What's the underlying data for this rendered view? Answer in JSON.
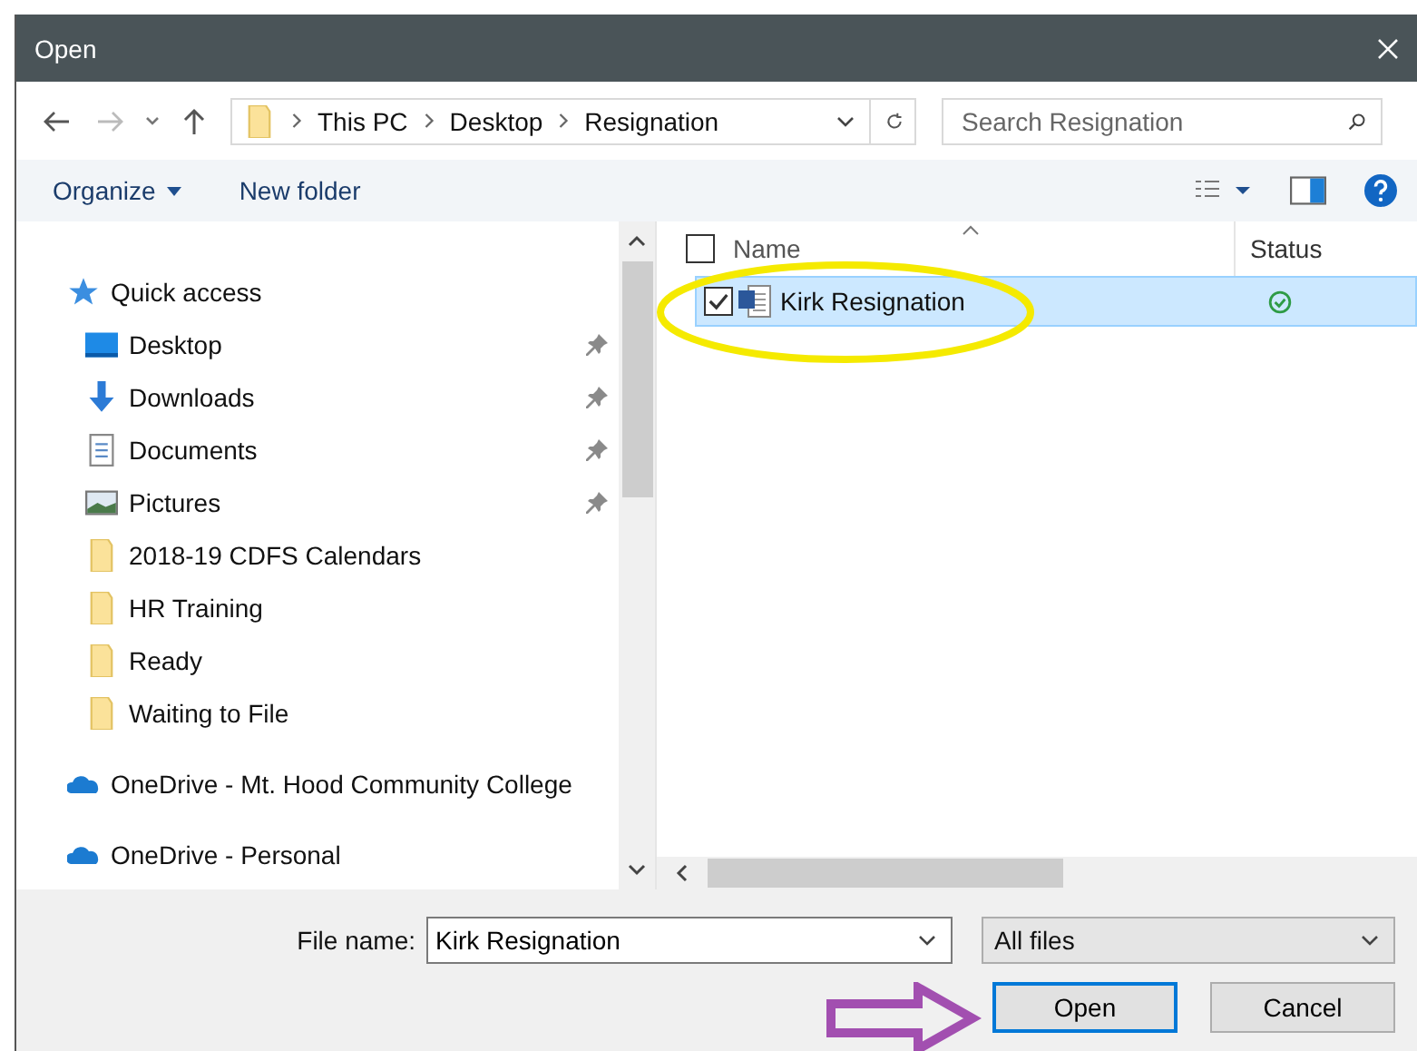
{
  "window": {
    "title": "Open"
  },
  "address": {
    "crumbs": [
      "This PC",
      "Desktop",
      "Resignation"
    ]
  },
  "search": {
    "placeholder": "Search Resignation"
  },
  "commands": {
    "organize": "Organize",
    "new_folder": "New folder"
  },
  "sidebar": {
    "items": [
      {
        "label": "Quick access",
        "kind": "quick-access",
        "children": [
          {
            "label": "Desktop",
            "kind": "desktop",
            "pinned": true
          },
          {
            "label": "Downloads",
            "kind": "downloads",
            "pinned": true
          },
          {
            "label": "Documents",
            "kind": "documents",
            "pinned": true
          },
          {
            "label": "Pictures",
            "kind": "pictures",
            "pinned": true
          },
          {
            "label": "2018-19 CDFS Calendars",
            "kind": "folder",
            "pinned": false
          },
          {
            "label": "HR Training",
            "kind": "folder",
            "pinned": false
          },
          {
            "label": "Ready",
            "kind": "folder",
            "pinned": false
          },
          {
            "label": "Waiting to File",
            "kind": "folder",
            "pinned": false
          }
        ]
      },
      {
        "label": "OneDrive - Mt. Hood Community College",
        "kind": "onedrive"
      },
      {
        "label": "OneDrive - Personal",
        "kind": "onedrive"
      }
    ]
  },
  "file_list": {
    "header_checked": false,
    "columns": [
      "Name",
      "Status"
    ],
    "rows": [
      {
        "name": "Kirk Resignation",
        "selected": true,
        "checked": true,
        "synced": true
      }
    ]
  },
  "file_name": {
    "label": "File name:",
    "value": "Kirk Resignation"
  },
  "file_type": {
    "value": "All files"
  },
  "buttons": [
    {
      "label": "Open",
      "default": true
    },
    {
      "label": "Cancel",
      "default": false
    }
  ]
}
